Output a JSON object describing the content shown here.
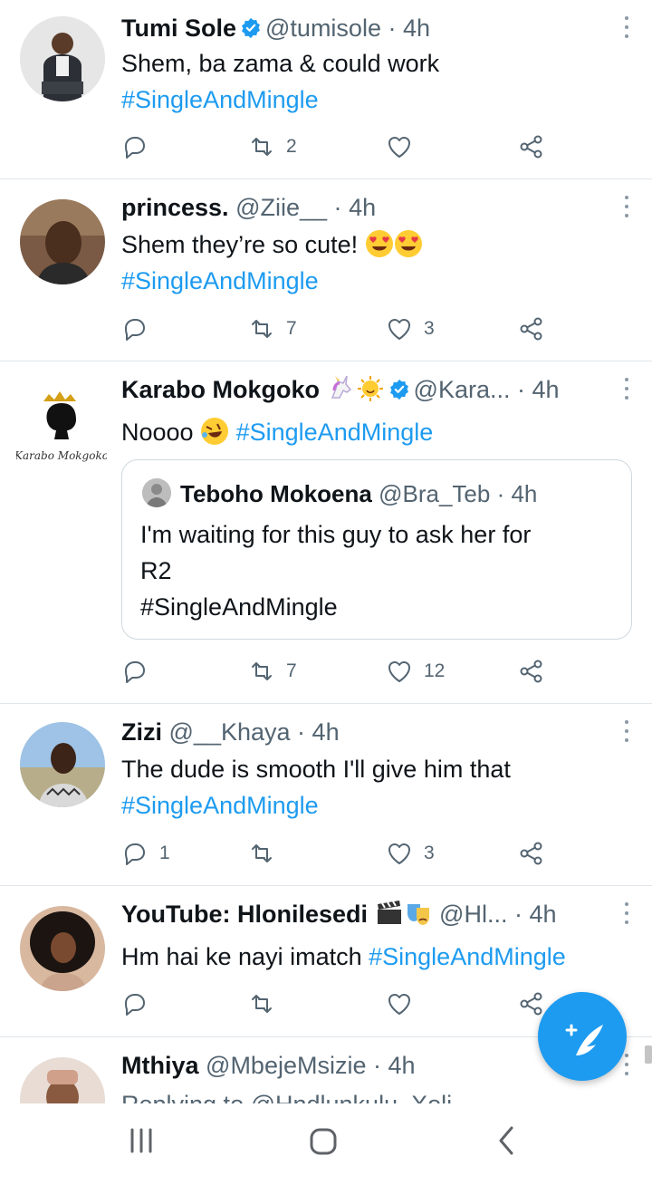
{
  "tweets": [
    {
      "name": "Tumi Sole",
      "handle": "@tumisole",
      "dot": "·",
      "time": "4h",
      "verified": true,
      "text": "Shem, ba zama & could work",
      "hashtag": "#SingleAndMingle",
      "replies": "",
      "retweets": "2",
      "likes": ""
    },
    {
      "name": "princess.",
      "handle": "@Ziie__",
      "dot": "·",
      "time": "4h",
      "text": "Shem they’re so cute!",
      "emojis": [
        "heart-eyes-emoji",
        "heart-eyes-emoji"
      ],
      "hashtag": "#SingleAndMingle",
      "replies": "",
      "retweets": "7",
      "likes": "3"
    },
    {
      "name": "Karabo Mokgoko",
      "name_emojis": [
        "unicorn-emoji",
        "sun-face-emoji"
      ],
      "verified": true,
      "handle": "@Kara...",
      "dot": "·",
      "time": "4h",
      "avatar_logo_text": "Karabo Mokgoko",
      "text": "Noooo",
      "text_emoji": "rolling-laughing-emoji",
      "hashtag": "#SingleAndMingle",
      "quote": {
        "name": "Teboho Mokoena",
        "handle": "@Bra_Teb",
        "dot": "·",
        "time": "4h",
        "text_line1": "I'm waiting for this guy to ask her for",
        "text_line2": "R2",
        "text_line3": "#SingleAndMingle"
      },
      "replies": "",
      "retweets": "7",
      "likes": "12"
    },
    {
      "name": "Zizi",
      "handle": "@__Khaya",
      "dot": "·",
      "time": "4h",
      "text": "The dude is smooth I'll give him that",
      "hashtag": "#SingleAndMingle",
      "replies": "1",
      "retweets": "",
      "likes": "3"
    },
    {
      "name": "YouTube: Hlonilesedi",
      "name_emojis": [
        "clapper-board-emoji",
        "performing-arts-emoji"
      ],
      "handle": "@Hl...",
      "dot": "·",
      "time": "4h",
      "text": "Hm hai ke nayi imatch",
      "hashtag": "#SingleAndMingle",
      "replies": "",
      "retweets": "",
      "likes": ""
    },
    {
      "name": "Mthiya",
      "handle": "@MbejeMsizie",
      "dot": "·",
      "time": "4h",
      "reply_partial": "Replying to @Hndlunkulu_Xoli"
    }
  ],
  "colors": {
    "accent": "#1d9bf0",
    "muted": "#536471",
    "divider": "#e1e6ea"
  },
  "fab": {
    "icon": "compose-tweet-icon"
  },
  "navbar": {
    "icons": [
      "recent-apps-icon",
      "home-icon",
      "back-icon"
    ]
  }
}
